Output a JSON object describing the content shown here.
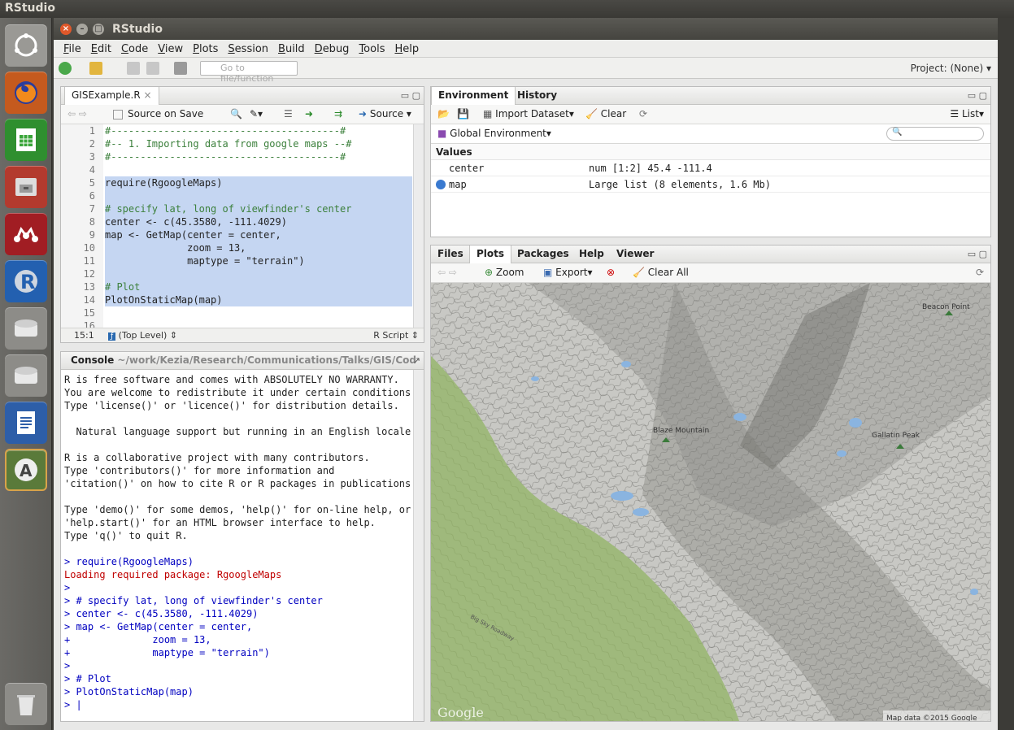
{
  "os": {
    "topbar_title": "RStudio"
  },
  "window": {
    "title": "RStudio",
    "menu": [
      "File",
      "Edit",
      "Code",
      "View",
      "Plots",
      "Session",
      "Build",
      "Debug",
      "Tools",
      "Help"
    ],
    "goto_placeholder": "Go to file/function",
    "project": "Project: (None)"
  },
  "editor": {
    "tab": "GISExample.R",
    "source_on_save": "Source on Save",
    "source_btn": "Source",
    "line_numbers": [
      "1",
      "2",
      "3",
      "4",
      "5",
      "6",
      "7",
      "8",
      "9",
      "10",
      "11",
      "12",
      "13",
      "14",
      "15",
      "16"
    ],
    "lines": [
      "#---------------------------------------#",
      "#-- 1. Importing data from google maps --#",
      "#---------------------------------------#",
      "",
      "require(RgoogleMaps)",
      "",
      "# specify lat, long of viewfinder's center",
      "center <- c(45.3580, -111.4029)",
      "map <- GetMap(center = center,",
      "              zoom = 13,",
      "              maptype = \"terrain\")",
      "",
      "# Plot",
      "PlotOnStaticMap(map)",
      "",
      ""
    ],
    "cursor_pos": "15:1",
    "scope": "(Top Level)",
    "file_type": "R Script"
  },
  "console": {
    "title": "Console",
    "path": "~/work/Kezia/Research/Communications/Talks/GIS/Cod",
    "lines": [
      {
        "text": "R is free software and comes with ABSOLUTELY NO WARRANTY.",
        "kind": "out"
      },
      {
        "text": "You are welcome to redistribute it under certain conditions.",
        "kind": "out"
      },
      {
        "text": "Type 'license()' or 'licence()' for distribution details.",
        "kind": "out"
      },
      {
        "text": "",
        "kind": "out"
      },
      {
        "text": "  Natural language support but running in an English locale",
        "kind": "out"
      },
      {
        "text": "",
        "kind": "out"
      },
      {
        "text": "R is a collaborative project with many contributors.",
        "kind": "out"
      },
      {
        "text": "Type 'contributors()' for more information and",
        "kind": "out"
      },
      {
        "text": "'citation()' on how to cite R or R packages in publications.",
        "kind": "out"
      },
      {
        "text": "",
        "kind": "out"
      },
      {
        "text": "Type 'demo()' for some demos, 'help()' for on-line help, or",
        "kind": "out"
      },
      {
        "text": "'help.start()' for an HTML browser interface to help.",
        "kind": "out"
      },
      {
        "text": "Type 'q()' to quit R.",
        "kind": "out"
      },
      {
        "text": "",
        "kind": "out"
      },
      {
        "text": "> require(RgoogleMaps)",
        "kind": "cmd"
      },
      {
        "text": "Loading required package: RgoogleMaps",
        "kind": "err"
      },
      {
        "text": ">",
        "kind": "cmd"
      },
      {
        "text": "> # specify lat, long of viewfinder's center",
        "kind": "cmd"
      },
      {
        "text": "> center <- c(45.3580, -111.4029)",
        "kind": "cmd"
      },
      {
        "text": "> map <- GetMap(center = center,",
        "kind": "cmd"
      },
      {
        "text": "+              zoom = 13,",
        "kind": "cmd"
      },
      {
        "text": "+              maptype = \"terrain\")",
        "kind": "cmd"
      },
      {
        "text": ">",
        "kind": "cmd"
      },
      {
        "text": "> # Plot",
        "kind": "cmd"
      },
      {
        "text": "> PlotOnStaticMap(map)",
        "kind": "cmd"
      },
      {
        "text": "> |",
        "kind": "cmd"
      }
    ]
  },
  "environment": {
    "tabs": [
      "Environment",
      "History"
    ],
    "import_dataset": "Import Dataset",
    "clear": "Clear",
    "view_mode": "List",
    "scope": "Global Environment",
    "section": "Values",
    "rows": [
      {
        "name": "center",
        "value": "num [1:2] 45.4 -111.4"
      },
      {
        "name": "map",
        "value": "Large list (8 elements, 1.6 Mb)"
      }
    ]
  },
  "files_pane": {
    "tabs": [
      "Files",
      "Plots",
      "Packages",
      "Help",
      "Viewer"
    ],
    "zoom": "Zoom",
    "export": "Export",
    "clear_all": "Clear All",
    "map_labels": {
      "beacon": "Beacon Point",
      "blaze": "Blaze Mountain",
      "gallatin": "Gallatin Peak",
      "road": "Big Sky Roadway",
      "google": "Google",
      "attribution": "Map data ©2015 Google"
    }
  }
}
